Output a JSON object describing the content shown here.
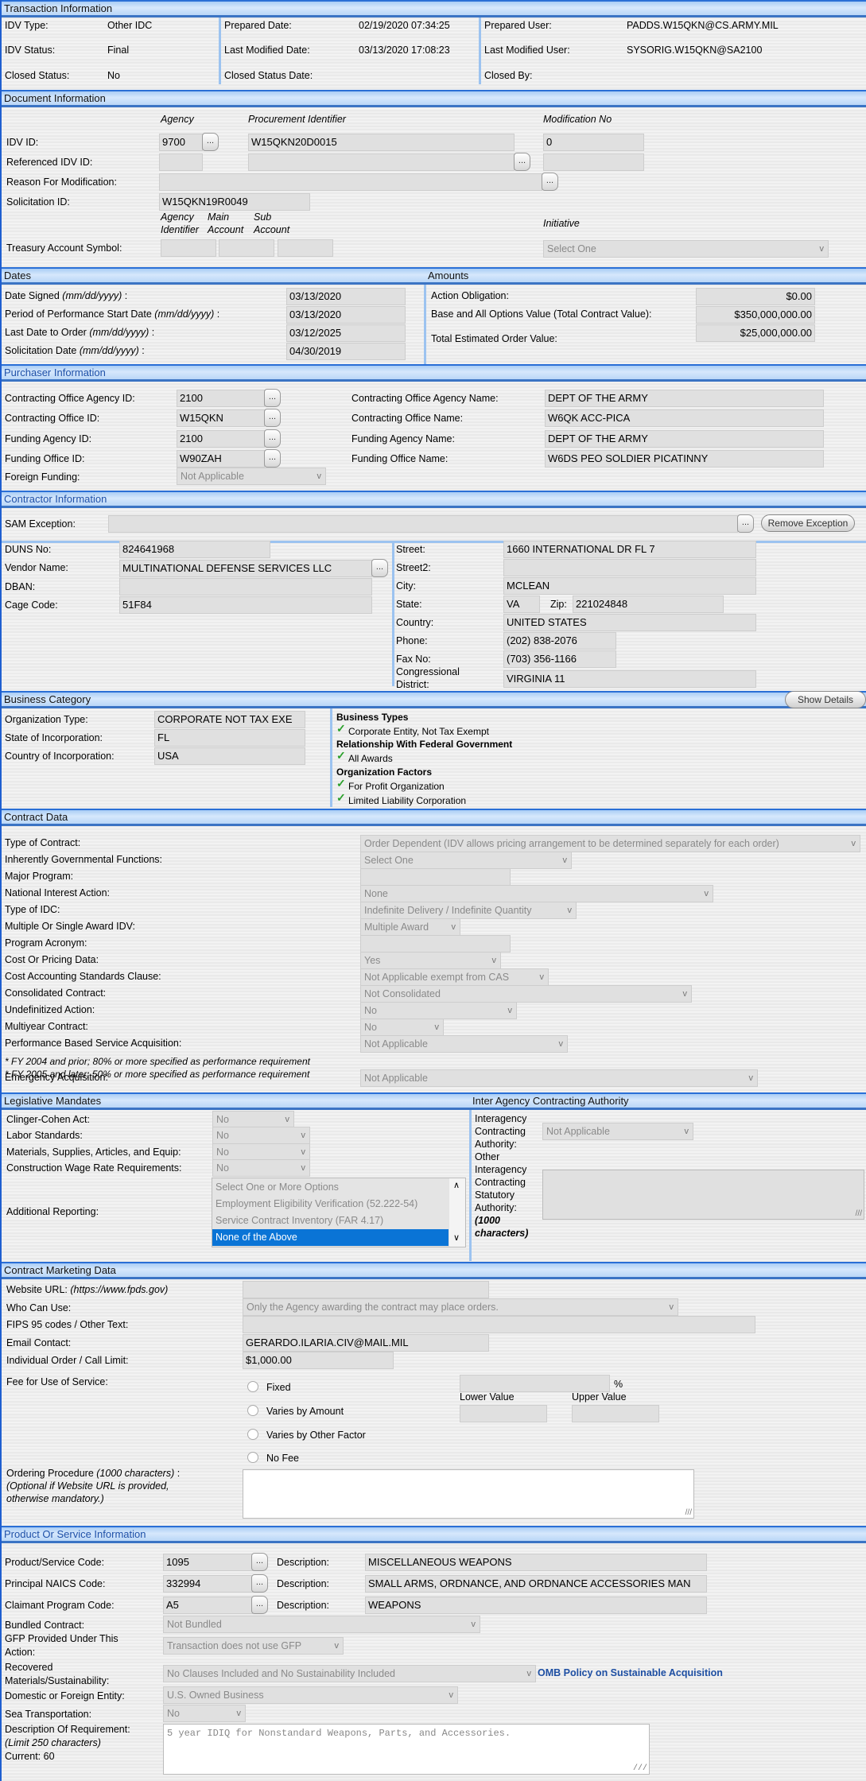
{
  "transaction": {
    "title": "Transaction Information",
    "idv_type_label": "IDV Type:",
    "idv_type": "Other IDC",
    "idv_status_label": "IDV Status:",
    "idv_status": "Final",
    "closed_status_label": "Closed Status:",
    "closed_status": "No",
    "prepared_date_label": "Prepared Date:",
    "prepared_date": "02/19/2020 07:34:25",
    "last_modified_date_label": "Last Modified Date:",
    "last_modified_date": "03/13/2020 17:08:23",
    "closed_status_date_label": "Closed Status Date:",
    "prepared_user_label": "Prepared User:",
    "prepared_user": "PADDS.W15QKN@CS.ARMY.MIL",
    "last_modified_user_label": "Last Modified User:",
    "last_modified_user": "SYSORIG.W15QKN@SA2100",
    "closed_by_label": "Closed By:"
  },
  "document": {
    "title": "Document Information",
    "col_agency": "Agency",
    "col_proc": "Procurement Identifier",
    "col_mod": "Modification No",
    "idv_id_label": "IDV ID:",
    "idv_agency": "9700",
    "idv_proc": "W15QKN20D0015",
    "idv_mod": "0",
    "ref_idv_label": "Referenced IDV ID:",
    "reason_label": "Reason For Modification:",
    "solicitation_label": "Solicitation ID:",
    "solicitation": "W15QKN19R0049",
    "tas_col1": "Agency Identifier",
    "tas_col1a": "Agency",
    "tas_col1b": "Identifier",
    "tas_col2a": "Main",
    "tas_col2b": "Account",
    "tas_col3a": "Sub",
    "tas_col3b": "Account",
    "initiative_label": "Initiative",
    "tas_label": "Treasury Account Symbol:",
    "initiative": "Select One",
    "ellipsis": "..."
  },
  "dates": {
    "title": "Dates",
    "signed_label": "Date Signed ",
    "pop_label": "Period of Performance Start Date ",
    "last_order_label": "Last Date to Order ",
    "solicit_label": "Solicitation Date ",
    "fmt": "(mm/dd/yyyy)",
    "colon": " :",
    "signed": "03/13/2020",
    "pop": "03/13/2020",
    "last_order": "03/12/2025",
    "solicit": "04/30/2019"
  },
  "amounts": {
    "title": "Amounts",
    "action_label": "Action Obligation:",
    "action": "$0.00",
    "base_label": "Base and All Options Value (Total Contract Value):",
    "base": "$350,000,000.00",
    "total_label": "Total Estimated Order Value:",
    "total": "$25,000,000.00"
  },
  "purchaser": {
    "title": "Purchaser Information",
    "coa_id_label": "Contracting Office Agency ID:",
    "coa_id": "2100",
    "co_id_label": "Contracting Office ID:",
    "co_id": "W15QKN",
    "fa_id_label": "Funding Agency ID:",
    "fa_id": "2100",
    "fo_id_label": "Funding Office ID:",
    "fo_id": "W90ZAH",
    "foreign_label": "Foreign Funding:",
    "foreign": "Not Applicable",
    "coa_name_label": "Contracting Office Agency Name:",
    "coa_name": "DEPT OF THE ARMY",
    "co_name_label": "Contracting Office Name:",
    "co_name": "W6QK ACC-PICA",
    "fa_name_label": "Funding Agency Name:",
    "fa_name": "DEPT OF THE ARMY",
    "fo_name_label": "Funding Office Name:",
    "fo_name": "W6DS PEO SOLDIER PICATINNY"
  },
  "contractor": {
    "title": "Contractor Information",
    "sam_label": "SAM Exception:",
    "remove_btn": "Remove Exception",
    "duns_label": "DUNS No:",
    "duns": "824641968",
    "vendor_label": "Vendor Name:",
    "vendor": "MULTINATIONAL DEFENSE SERVICES LLC",
    "dban_label": "DBAN:",
    "cage_label": "Cage Code:",
    "cage": "51F84",
    "street_label": "Street:",
    "street": "1660 INTERNATIONAL DR FL 7",
    "street2_label": "Street2:",
    "city_label": "City:",
    "city": "MCLEAN",
    "state_label": "State:",
    "state": "VA",
    "zip_label": "Zip:",
    "zip": "221024848",
    "country_label": "Country:",
    "country": "UNITED STATES",
    "phone_label": "Phone:",
    "phone": "(202) 838-2076",
    "fax_label": "Fax No:",
    "fax": "(703) 356-1166",
    "district_label1": "Congressional",
    "district_label2": "District:",
    "district": "VIRGINIA 11"
  },
  "business": {
    "title": "Business Category",
    "show_btn": "Show Details",
    "org_type_label": "Organization Type:",
    "org_type": "CORPORATE NOT TAX EXE",
    "state_label": "State of Incorporation:",
    "state": "FL",
    "country_label": "Country of Incorporation:",
    "country": "USA",
    "groups": [
      {
        "heading": "Business Types",
        "items": [
          "Corporate Entity, Not Tax Exempt"
        ]
      },
      {
        "heading": "Relationship With Federal Government",
        "items": [
          "All Awards"
        ]
      },
      {
        "heading": "Organization Factors",
        "items": [
          "For Profit Organization",
          "Limited Liability Corporation"
        ]
      }
    ]
  },
  "contract": {
    "title": "Contract Data",
    "rows": [
      {
        "label": "Type of Contract:",
        "value": "Order Dependent (IDV allows pricing arrangement to be determined separately for each order)"
      },
      {
        "label": "Inherently Governmental Functions:",
        "value": "Select One"
      },
      {
        "label": "Major Program:",
        "value": ""
      },
      {
        "label": "National Interest Action:",
        "value": "None"
      },
      {
        "label": "Type of IDC:",
        "value": "Indefinite Delivery / Indefinite Quantity"
      },
      {
        "label": "Multiple Or Single Award IDV:",
        "value": "Multiple Award"
      },
      {
        "label": "Program Acronym:",
        "value": ""
      },
      {
        "label": "Cost Or Pricing Data:",
        "value": "Yes"
      },
      {
        "label": "Cost Accounting Standards Clause:",
        "value": "Not Applicable exempt from CAS"
      },
      {
        "label": "Consolidated Contract:",
        "value": "Not Consolidated"
      },
      {
        "label": "Undefinitized Action:",
        "value": "No"
      },
      {
        "label": "Multiyear Contract:",
        "value": "No"
      },
      {
        "label": "Performance Based Service Acquisition:",
        "value": "Not Applicable"
      },
      {
        "label": "Emergency Acquisition:",
        "value": "Not Applicable"
      }
    ],
    "pbsa_note1": "* FY 2004 and prior; 80% or more specified as performance requirement",
    "pbsa_note2": "* FY 2005 and later; 50% or more specified as performance requirement"
  },
  "legislative": {
    "title": "Legislative Mandates",
    "clinger_label": "Clinger-Cohen Act:",
    "clinger": "No",
    "labor_label": "Labor Standards:",
    "labor": "No",
    "materials_label": "Materials, Supplies, Articles, and Equip:",
    "materials": "No",
    "wage_label": "Construction Wage Rate Requirements:",
    "wage": "No",
    "additional_label": "Additional Reporting:",
    "options": [
      "Select One or More Options",
      "Employment Eligibility Verification (52.222-54)",
      "Service Contract Inventory (FAR 4.17)",
      "None of the Above"
    ],
    "selected": "None of the Above"
  },
  "interagency": {
    "title": "Inter Agency Contracting Authority",
    "auth_label": [
      "Interagency",
      "Contracting",
      "Authority:"
    ],
    "auth": "Not Applicable",
    "other_label": [
      "Other",
      "Interagency",
      "Contracting",
      "Statutory",
      "Authority:"
    ],
    "other_note": [
      "(1000",
      "characters)"
    ]
  },
  "marketing": {
    "title": "Contract Marketing Data",
    "website_label": "Website URL: ",
    "website_hint": "(https://www.fpds.gov)",
    "who_label": "Who Can Use:",
    "who": "Only the Agency awarding the contract may place orders.",
    "fips_label": "FIPS 95 codes / Other Text:",
    "email_label": "Email Contact:",
    "email": "GERARDO.ILARIA.CIV@MAIL.MIL",
    "limit_label": "Individual Order / Call Limit:",
    "limit": "$1,000.00",
    "fee_label": "Fee for Use of Service:",
    "fee_options": [
      "Fixed",
      "Varies by Amount",
      "Varies by Other Factor",
      "No Fee"
    ],
    "percent": "%",
    "lower_label": "Lower Value",
    "upper_label": "Upper Value",
    "ordering_label": "Ordering Procedure ",
    "ordering_hint": "(1000 characters)",
    "ordering_note1": "(Optional if Website URL is provided,",
    "ordering_note2": "otherwise mandatory.)"
  },
  "product": {
    "title": "Product Or Service Information",
    "psc_label": "Product/Service Code:",
    "psc": "1095",
    "psc_desc": "MISCELLANEOUS WEAPONS",
    "naics_label": "Principal NAICS Code:",
    "naics": "332994",
    "naics_desc": "SMALL ARMS, ORDNANCE, AND ORDNANCE ACCESSORIES MAN",
    "claimant_label": "Claimant Program Code:",
    "claimant": "A5",
    "claimant_desc": "WEAPONS",
    "desc_label": "Description:",
    "bundled_label": "Bundled Contract:",
    "bundled": "Not Bundled",
    "gfp_label1": "GFP Provided Under This",
    "gfp_label2": "Action:",
    "gfp": "Transaction does not use GFP",
    "recovered_label1": "Recovered",
    "recovered_label2": "Materials/Sustainability:",
    "recovered": "No Clauses Included and No Sustainability Included",
    "omb_link": "OMB Policy on Sustainable Acquisition",
    "domestic_label": "Domestic or Foreign Entity:",
    "domestic": "U.S. Owned Business",
    "sea_label": "Sea Transportation:",
    "sea": "No",
    "req_label": "Description Of Requirement:",
    "req_hint": "(Limit 250 characters)",
    "req_current": "Current: 60",
    "req": "5 year IDIQ for Nonstandard Weapons, Parts, and Accessories."
  },
  "icons": {
    "ellipsis": "ellipsis-icon",
    "chevron": "chevron-down-icon",
    "check": "checkmark-icon"
  },
  "colors": {
    "header_border": "#2a6fd6",
    "header_blue_text": "#1e50a8",
    "selected": "#0a74d6",
    "check": "#2aa02a"
  }
}
